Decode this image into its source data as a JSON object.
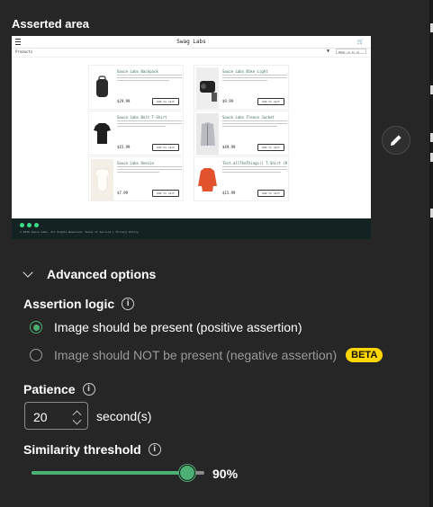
{
  "asserted_area": {
    "title": "Asserted area",
    "screenshot": {
      "logo": "Swag Labs",
      "products_label": "Products",
      "sort_value": "Name (A to Z)",
      "items": [
        {
          "name": "Sauce Labs Backpack",
          "price": "$29.99",
          "button": "Add to cart"
        },
        {
          "name": "Sauce Labs Bike Light",
          "price": "$9.99",
          "button": "Add to cart"
        },
        {
          "name": "Sauce Labs Bolt T-Shirt",
          "price": "$15.99",
          "button": "Add to cart"
        },
        {
          "name": "Sauce Labs Fleece Jacket",
          "price": "$49.99",
          "button": "Add to cart"
        },
        {
          "name": "Sauce Labs Onesie",
          "price": "$7.99",
          "button": "Add to cart"
        },
        {
          "name": "Test.allTheThings() T-Shirt (Red)",
          "price": "$15.99",
          "button": "Add to cart"
        }
      ],
      "footer_text": "© 2026 Sauce Labs. All Rights Reserved. Terms of Service | Privacy Policy"
    }
  },
  "advanced": {
    "label": "Advanced options"
  },
  "assertion_logic": {
    "label": "Assertion logic",
    "options": [
      {
        "label": "Image should be present (positive assertion)",
        "selected": true
      },
      {
        "label": "Image should NOT be present (negative assertion)",
        "selected": false,
        "badge": "BETA"
      }
    ]
  },
  "patience": {
    "label": "Patience",
    "value": "20",
    "unit": "second(s)"
  },
  "similarity": {
    "label": "Similarity threshold",
    "value": 90,
    "display": "90%"
  },
  "colors": {
    "accent": "#4caf73",
    "beta": "#ffd600",
    "background": "#262626"
  },
  "icons": {
    "edit": "pencil-icon",
    "info": "info-icon",
    "collapse": "chevron-down-icon"
  }
}
